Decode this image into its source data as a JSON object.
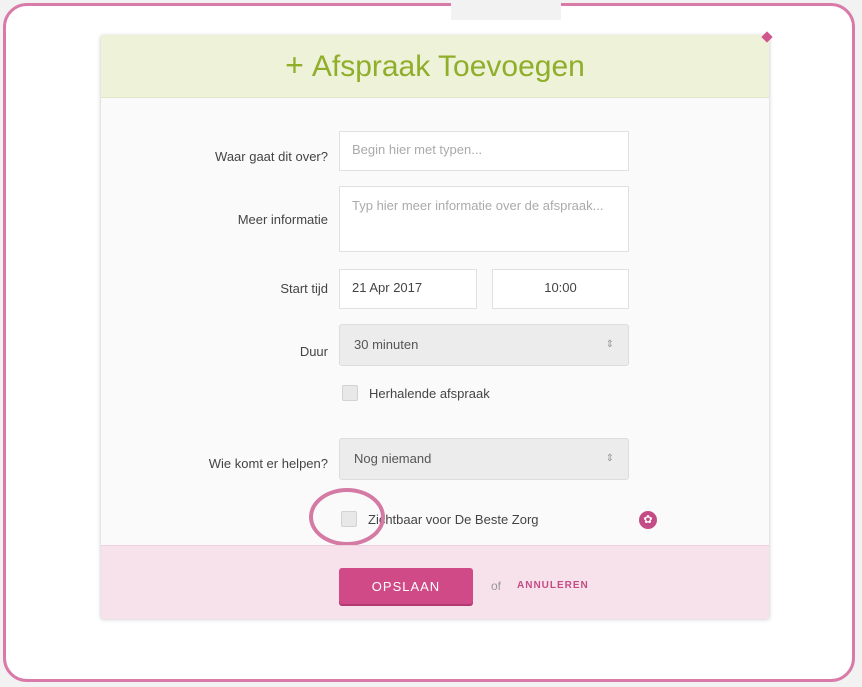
{
  "dialog": {
    "title": "Afspraak Toevoegen",
    "plus_icon": "+"
  },
  "form": {
    "subject": {
      "label": "Waar gaat dit over?",
      "placeholder": "Begin hier met typen..."
    },
    "info": {
      "label": "Meer informatie",
      "placeholder": "Typ hier meer informatie over de afspraak..."
    },
    "start": {
      "label": "Start tijd",
      "date": "21 Apr 2017",
      "time": "10:00"
    },
    "duration": {
      "label": "Duur",
      "value": "30 minuten"
    },
    "recurring": {
      "label": "Herhalende afspraak",
      "checked": false
    },
    "helper": {
      "label": "Wie komt er helpen?",
      "value": "Nog niemand"
    },
    "visible": {
      "label": "Zichtbaar voor De Beste Zorg",
      "checked": false
    }
  },
  "footer": {
    "save_label": "OPSLAAN",
    "or_label": "of",
    "cancel_label": "ANNULEREN"
  },
  "colors": {
    "accent": "#cf4a86",
    "title_green": "#8fae2a",
    "header_bg": "#eef2d8",
    "footer_bg": "#f7e2ec"
  },
  "icons": {
    "select_arrow": "select-arrows-icon",
    "info": "info-icon"
  }
}
